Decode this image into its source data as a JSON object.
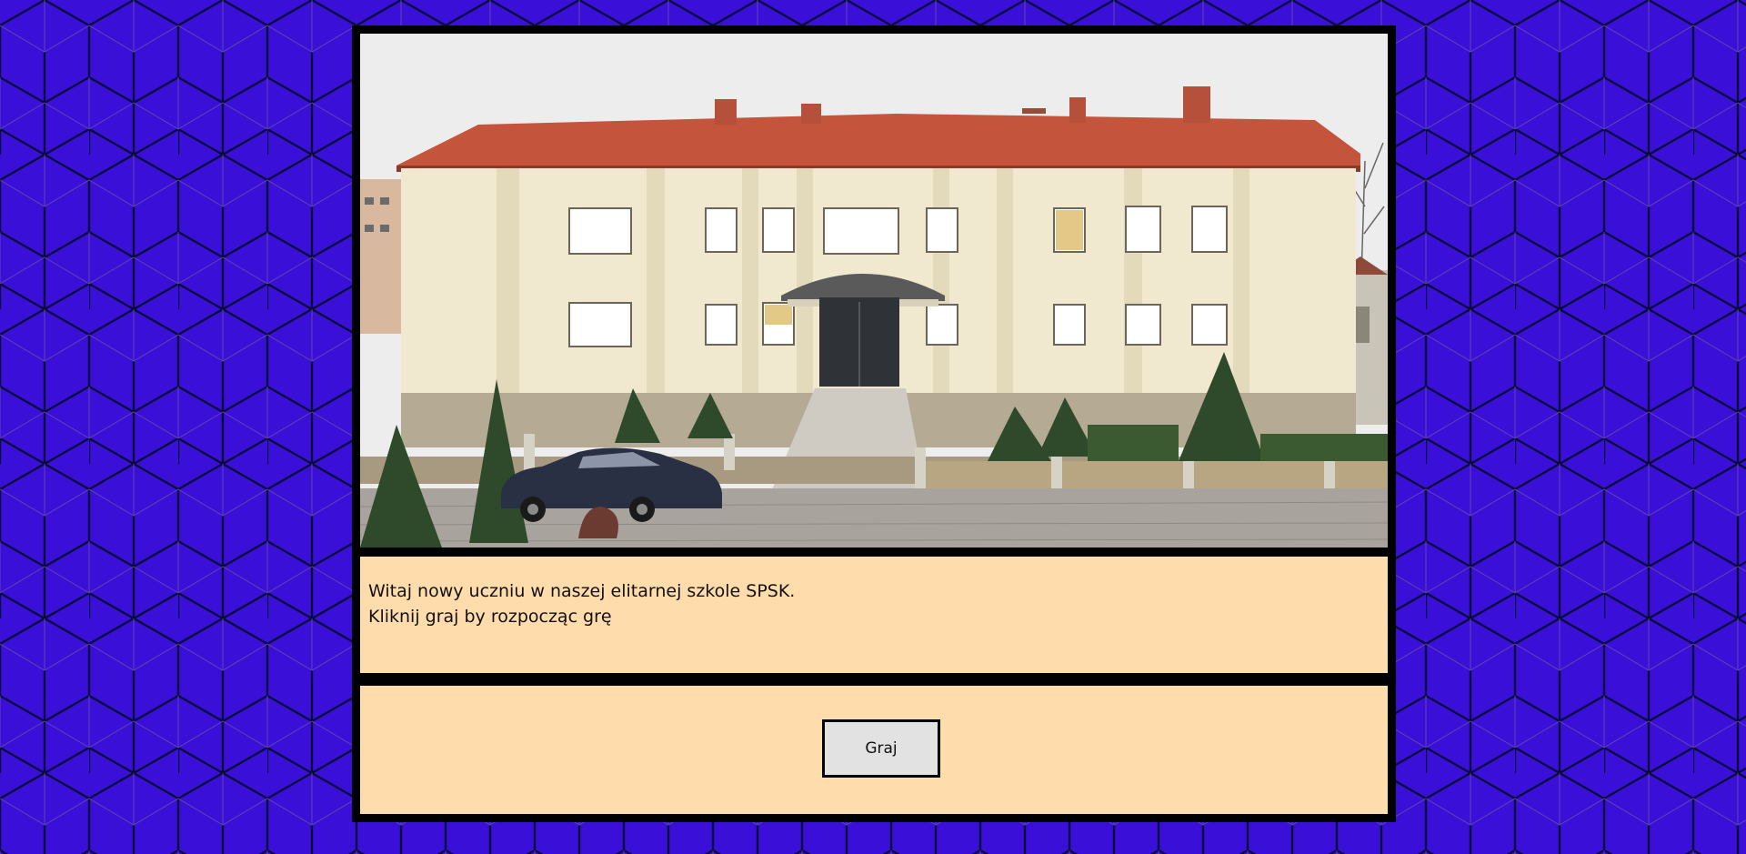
{
  "background": {
    "color": "#3a0fd8",
    "pattern": "isometric-cubes"
  },
  "photo": {
    "alt": "School building"
  },
  "message": {
    "line1": "Witaj nowy uczniu w naszej elitarnej szkole SPSK.",
    "line2": "Kliknij graj by rozpocząc grę"
  },
  "actions": {
    "play_label": "Graj"
  },
  "colors": {
    "panel": "#ffdcab",
    "frame": "#000000",
    "button": "#e2e2e2"
  }
}
